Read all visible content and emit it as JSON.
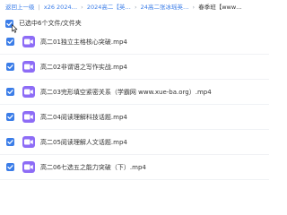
{
  "breadcrumb": {
    "items": [
      "返回上一级",
      "x26 2024…",
      "2024高二【英…",
      "24高二张冰瑶英…",
      "春季班【www…"
    ],
    "separators": [
      "|",
      "›",
      "›",
      "›"
    ]
  },
  "selection": {
    "label": "已选中6个文件/文件夹",
    "checked": true
  },
  "files": [
    {
      "name": "高二01独立主格核心突破.mp4",
      "checked": true,
      "icon": "video-file-icon"
    },
    {
      "name": "高二02非谓语之写作实战.mp4",
      "checked": true,
      "icon": "video-file-icon"
    },
    {
      "name": "高二03完形填空紧密关系（学霸网 www.xue-ba.org）.mp4",
      "checked": true,
      "icon": "video-file-icon"
    },
    {
      "name": "高二04阅读理解科技话题.mp4",
      "checked": true,
      "icon": "video-file-icon"
    },
    {
      "name": "高二05阅读理解人文话题.mp4",
      "checked": true,
      "icon": "video-file-icon"
    },
    {
      "name": "高二06七选五之能力突破（下）.mp4",
      "checked": true,
      "icon": "video-file-icon"
    }
  ],
  "colors": {
    "accent": "#3b7de8",
    "video_icon": "#8d6cf6"
  }
}
